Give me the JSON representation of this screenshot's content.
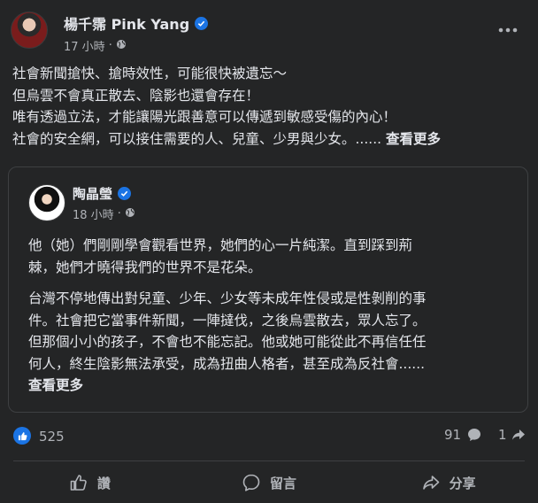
{
  "post": {
    "author": "楊千霈 Pink Yang",
    "time": "17 小時",
    "separator": "·",
    "lines": [
      "社會新聞搶快、搶時效性，可能很快被遺忘～",
      "但烏雲不會真正散去、陰影也還會存在！",
      "唯有透過立法，才能讓陽光跟善意可以傳遞到敏感受傷的內心！",
      "社會的安全網，可以接住需要的人、兒童、少男與少女。......"
    ],
    "see_more": "查看更多"
  },
  "shared": {
    "author": "陶晶瑩",
    "time": "18 小時",
    "separator": "·",
    "para1": [
      "他（她）們剛剛學會觀看世界，她們的心一片純潔。直到踩到荊",
      "棘，她們才曉得我們的世界不是花朵。"
    ],
    "para2": [
      "台灣不停地傳出對兒童、少年、少女等未成年性侵或是性剝削的事",
      "件。社會把它當事件新聞，一陣撻伐，之後烏雲散去，眾人忘了。",
      "但那個小小的孩子，不會也不能忘記。他或她可能從此不再信任任",
      "何人，終生陰影無法承受，成為扭曲人格者，甚至成為反社會......"
    ],
    "see_more": "查看更多"
  },
  "stats": {
    "likes": "525",
    "comments": "91",
    "shares": "1"
  },
  "actions": {
    "like": "讚",
    "comment": "留言",
    "share": "分享"
  },
  "colors": {
    "background": "#242526",
    "text": "#e4e6eb",
    "muted": "#b0b3b8",
    "accent": "#1b74e4"
  },
  "icons": [
    "verified-icon",
    "globe-icon",
    "more-icon",
    "like-icon",
    "comment-icon",
    "share-icon"
  ]
}
